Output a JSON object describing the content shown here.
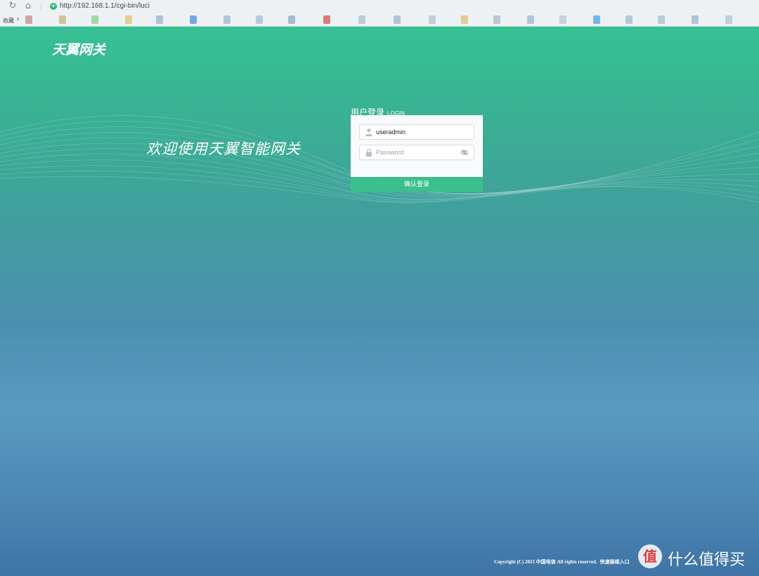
{
  "browser": {
    "url": "http://192.168.1.1/cgi-bin/luci",
    "favorites_label": "收藏",
    "colors": {
      "secure": "#2bb673"
    }
  },
  "brand": {
    "logo_text": "天翼网关"
  },
  "welcome_text": "欢迎使用天翼智能网关",
  "login": {
    "title_cn": "用户登录",
    "title_en": "LOGIN",
    "username_value": "useradmin",
    "password_placeholder": "Password",
    "submit_label": "确认登录",
    "colors": {
      "accent": "#3cbf8e"
    }
  },
  "footer": {
    "copyright": "Copyright (C) 2015 中国电信 All rights reserved.",
    "quick_link": "快速装维入口"
  },
  "watermark": {
    "badge": "值",
    "text": "什么值得买"
  }
}
